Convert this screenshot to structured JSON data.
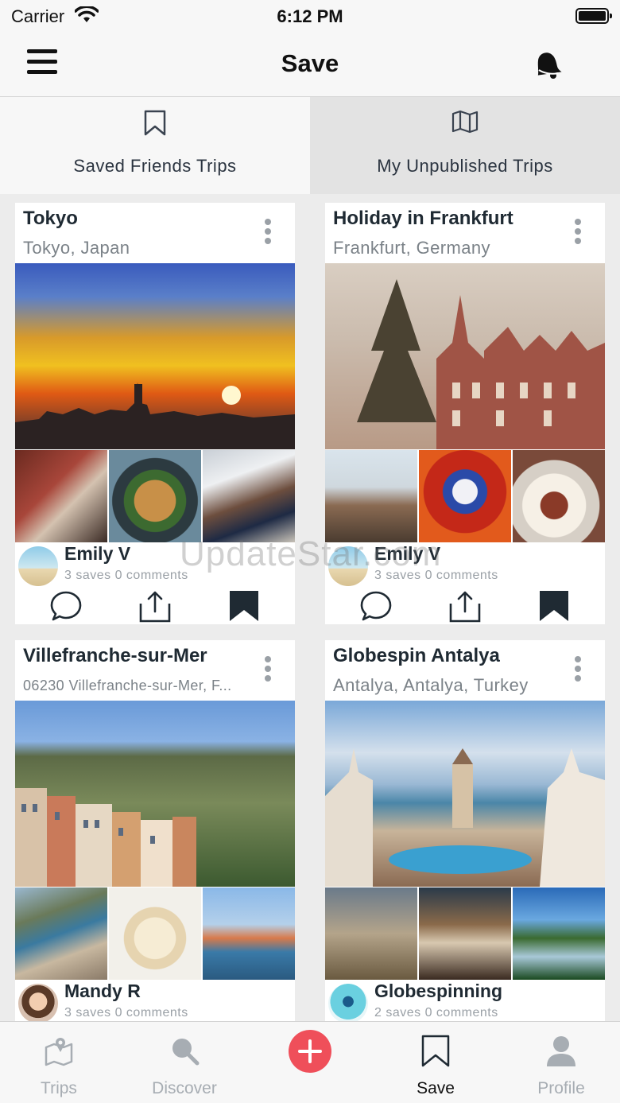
{
  "status": {
    "carrier": "Carrier",
    "time": "6:12 PM"
  },
  "navbar": {
    "title": "Save"
  },
  "segments": [
    {
      "label": "Saved Friends Trips",
      "icon": "bookmark-icon"
    },
    {
      "label": "My Unpublished Trips",
      "icon": "map-icon"
    }
  ],
  "cards": [
    {
      "title": "Tokyo",
      "location": "Tokyo, Japan",
      "user": "Emily V",
      "stats": "3 saves  0 comments"
    },
    {
      "title": "Holiday in Frankfurt",
      "location": "Frankfurt, Germany",
      "user": "Emily V",
      "stats": "3 saves  0 comments"
    },
    {
      "title": "Villefranche-sur-Mer",
      "location": "06230 Villefranche-sur-Mer, F...",
      "user": "Mandy R",
      "stats": "3 saves  0 comments"
    },
    {
      "title": "Globespin Antalya",
      "location": "Antalya, Antalya, Turkey",
      "user": "Globespinning",
      "stats": "2 saves  0 comments"
    }
  ],
  "watermark": "UpdateStar.com",
  "tabbar": {
    "items": [
      {
        "label": "Trips",
        "icon": "map-pin-icon"
      },
      {
        "label": "Discover",
        "icon": "search-icon"
      },
      {
        "label": "",
        "icon": "add-icon"
      },
      {
        "label": "Save",
        "icon": "bookmark-icon"
      },
      {
        "label": "Profile",
        "icon": "person-icon"
      }
    ]
  },
  "colors": {
    "accent": "#ef4f5a",
    "text": "#1f2a33",
    "muted": "#9aa0a6"
  }
}
